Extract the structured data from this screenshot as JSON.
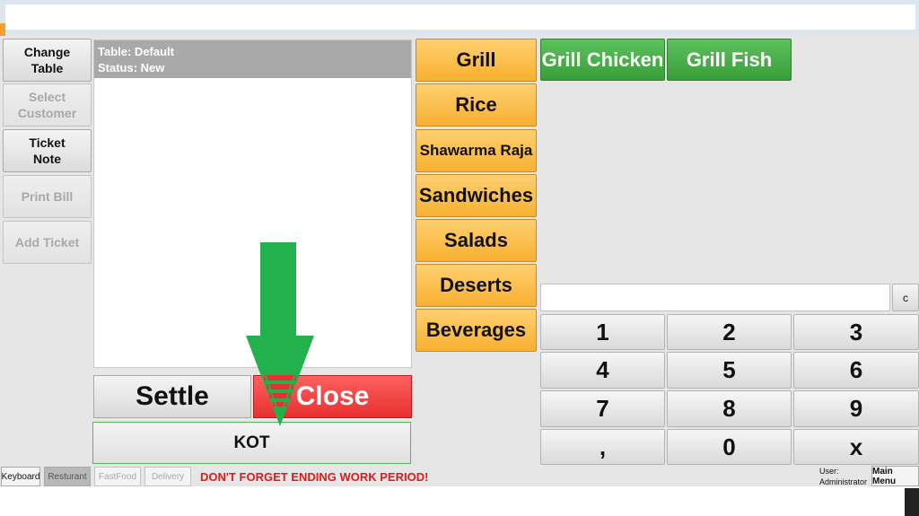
{
  "left_panel": {
    "change_table": "Change\nTable",
    "select_customer": "Select\nCustomer",
    "ticket_note": "Ticket\nNote",
    "print_bill": "Print Bill",
    "add_ticket": "Add Ticket"
  },
  "ticket": {
    "table_line": "Table: Default",
    "status_line": "Status: New"
  },
  "actions": {
    "settle": "Settle",
    "close": "Close",
    "kot": "KOT"
  },
  "categories": [
    "Grill",
    "Rice",
    "Shawarma Raja",
    "Sandwiches",
    "Salads",
    "Deserts",
    "Beverages"
  ],
  "menu_items": [
    "Grill Chicken",
    "Grill Fish"
  ],
  "numpad": {
    "display_value": "",
    "clear": "c",
    "keys": [
      "1",
      "2",
      "3",
      "4",
      "5",
      "6",
      "7",
      "8",
      "9",
      ",",
      "0",
      "x"
    ]
  },
  "status_bar": {
    "keyboard": "Keyboard",
    "resturant": "Resturant",
    "fastfood": "FastFood",
    "delivery": "Delivery",
    "warning": "DON'T FORGET ENDING WORK PERIOD!",
    "user_label": "User:",
    "user_name": "Administrator",
    "main_menu": "Main Menu"
  },
  "colors": {
    "category": "#f8b030",
    "menu_item": "#3a9d3a",
    "close": "#ee3a3a",
    "warning": "#d81e1e",
    "arrow": "#22b14c"
  }
}
